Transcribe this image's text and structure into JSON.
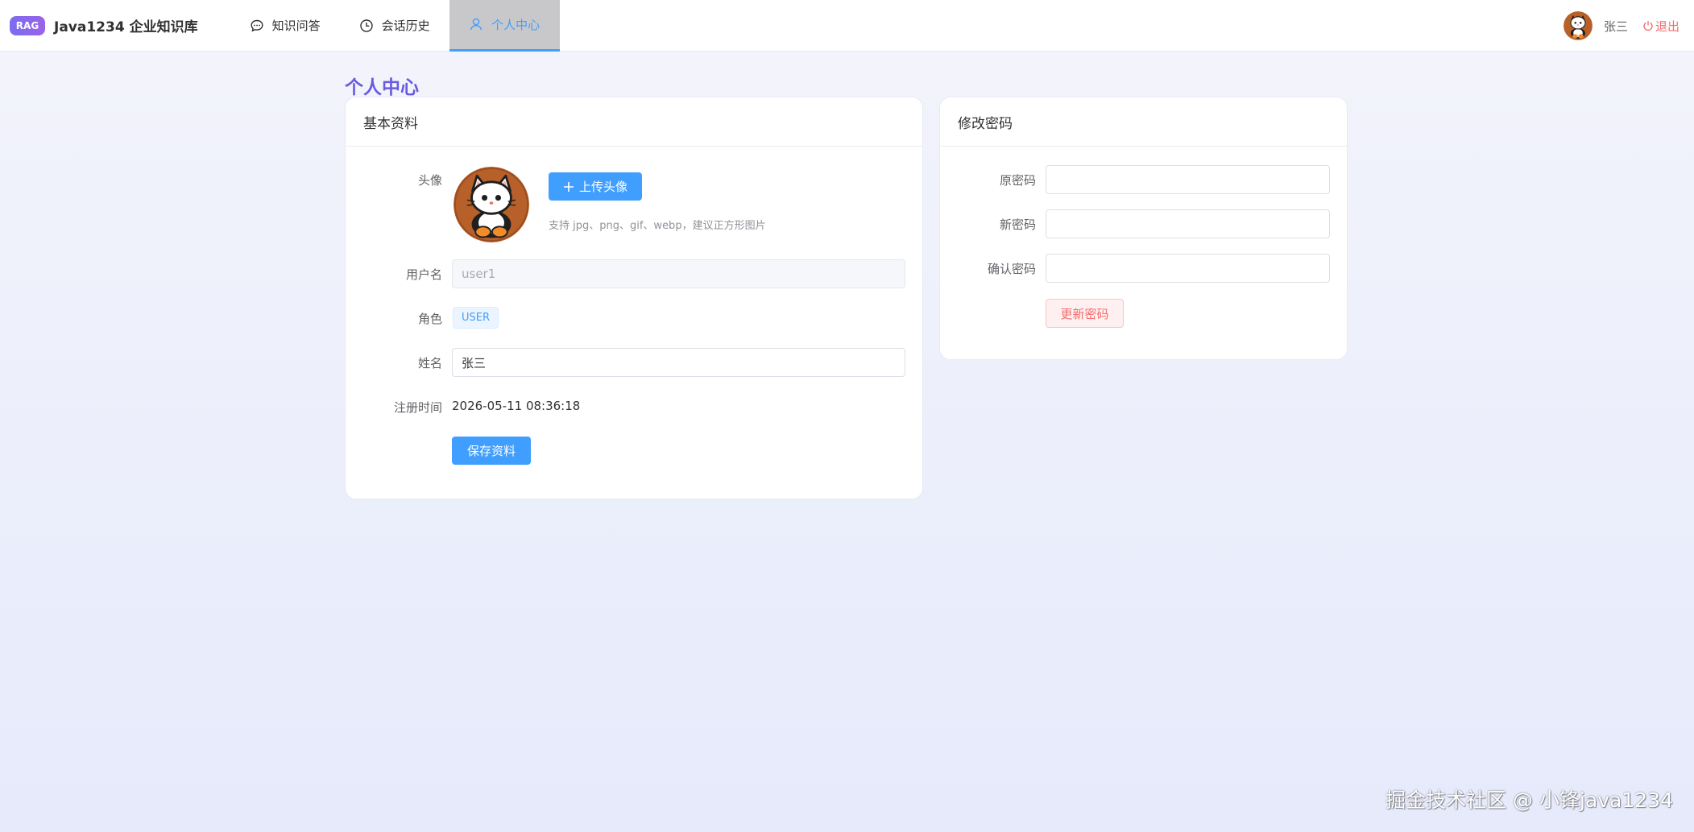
{
  "header": {
    "brand_badge": "RAG",
    "brand_title": "Java1234 企业知识库",
    "nav": [
      {
        "label": "知识问答",
        "icon": "chat-icon"
      },
      {
        "label": "会话历史",
        "icon": "clock-icon"
      },
      {
        "label": "个人中心",
        "icon": "user-icon",
        "active": true
      }
    ],
    "user_name": "张三",
    "logout_label": "退出"
  },
  "page": {
    "title": "个人中心"
  },
  "profile_card": {
    "title": "基本资料",
    "avatar_label": "头像",
    "upload_label": "上传头像",
    "upload_hint": "支持 jpg、png、gif、webp，建议正方形图片",
    "username_label": "用户名",
    "username_value": "user1",
    "role_label": "角色",
    "role_value": "USER",
    "name_label": "姓名",
    "name_value": "张三",
    "register_label": "注册时间",
    "register_value": "2026-05-11 08:36:18",
    "save_label": "保存资料"
  },
  "password_card": {
    "title": "修改密码",
    "old_label": "原密码",
    "new_label": "新密码",
    "confirm_label": "确认密码",
    "update_label": "更新密码"
  },
  "watermark": "掘金技术社区 @ 小锋java1234",
  "colors": {
    "primary": "#409eff",
    "accent": "#6a5ae0",
    "danger": "#f56c6c"
  }
}
